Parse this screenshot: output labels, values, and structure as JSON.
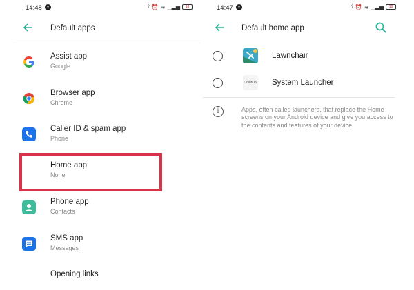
{
  "left_screen": {
    "status": {
      "time": "14:48",
      "notification_badge": "•",
      "battery_level": "18"
    },
    "header": {
      "title": "Default apps"
    },
    "apps": [
      {
        "title": "Assist app",
        "subtitle": "Google",
        "icon": "google-icon"
      },
      {
        "title": "Browser app",
        "subtitle": "Chrome",
        "icon": "chrome-icon"
      },
      {
        "title": "Caller ID & spam app",
        "subtitle": "Phone",
        "icon": "phone-icon"
      },
      {
        "title": "Home app",
        "subtitle": "None",
        "icon": "none"
      },
      {
        "title": "Phone app",
        "subtitle": "Contacts",
        "icon": "contacts-icon"
      },
      {
        "title": "SMS app",
        "subtitle": "Messages",
        "icon": "messages-icon"
      },
      {
        "title": "Opening links",
        "subtitle": "",
        "icon": "none"
      }
    ]
  },
  "right_screen": {
    "status": {
      "time": "14:47",
      "notification_badge": "•",
      "battery_level": "18"
    },
    "header": {
      "title": "Default home app"
    },
    "launchers": [
      {
        "label": "Lawnchair",
        "icon": "lawnchair-icon",
        "selected": false
      },
      {
        "label": "System Launcher",
        "icon_text": "ColorOS",
        "icon": "coloros-icon",
        "selected": false
      }
    ],
    "info_text": "Apps, often called launchers, that replace the Home screens on your Android device and give you access to the contents and features of your device"
  },
  "colors": {
    "accent": "#2bb39a",
    "highlight": "#d9334a"
  }
}
